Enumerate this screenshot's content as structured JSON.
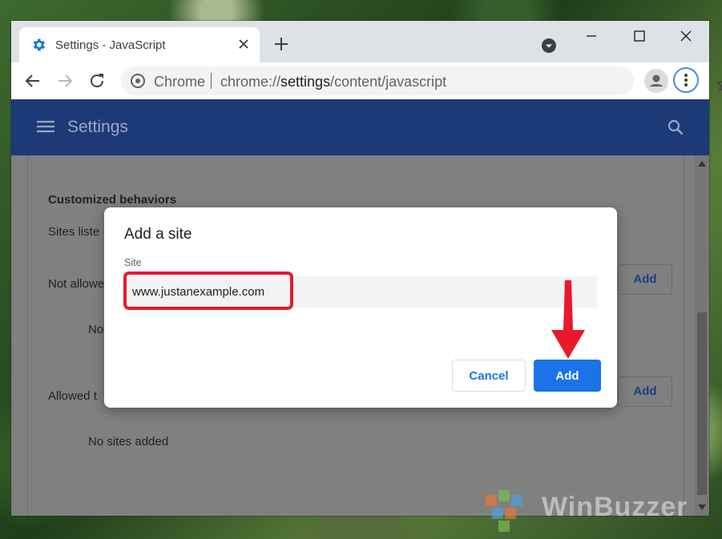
{
  "browser": {
    "tab": {
      "title": "Settings - JavaScript",
      "icon": "gear-icon"
    },
    "omnibox": {
      "scheme_label": "Chrome",
      "url_prefix": "chrome://",
      "url_host": "settings",
      "url_path": "/content/javascript"
    }
  },
  "app": {
    "title": "Settings"
  },
  "background": {
    "section_heading": "Customized behaviors",
    "sites_listed": "Sites liste",
    "not_allowed": "Not allowe",
    "no_sites_partial": "No",
    "allowed": "Allowed t",
    "add_label_1": "Add",
    "add_label_2": "Add",
    "no_sites_added": "No sites added"
  },
  "dialog": {
    "title": "Add a site",
    "field_label": "Site",
    "field_value": "www.justanexample.com",
    "cancel_label": "Cancel",
    "add_label": "Add"
  },
  "watermark": {
    "text": "WinBuzzer"
  },
  "colors": {
    "accent": "#1a73e8",
    "appbar": "#1c3a78",
    "highlight": "#e8192c"
  }
}
